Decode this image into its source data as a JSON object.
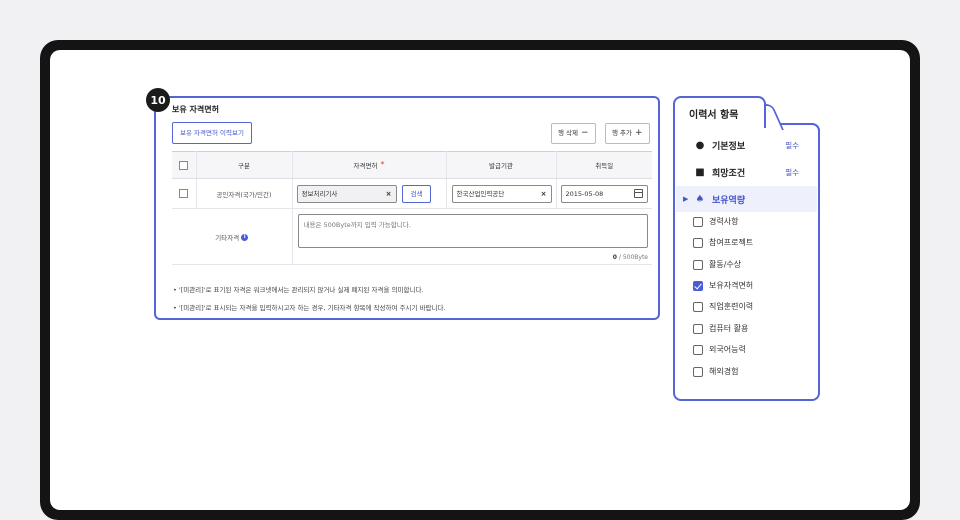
{
  "badge": "10",
  "panel": {
    "title": "보유 자격면허",
    "view_button": "보유 자격면허 이력보기",
    "delete_row": "행 삭제",
    "delete_symbol": "−",
    "add_row": "행 추가",
    "add_symbol": "+",
    "headers": {
      "type": "구분",
      "license": "자격면허",
      "issuer": "발급기관",
      "date": "취득일"
    },
    "required_mark": "*",
    "row": {
      "type": "공인자격(국가/민간)",
      "license_value": "정보처리기사",
      "search_button": "검색",
      "issuer_value": "한국산업인력공단",
      "date_value": "2015-05-08"
    },
    "other": {
      "label": "기타자격",
      "info_icon": "i",
      "placeholder": "내용은 500Byte까지 입력 가능합니다.",
      "count": "0",
      "limit": "/ 500Byte"
    },
    "notes": [
      "• '[미관리]'로 표기된 자격은 워크넷에서는 관리되지 않거나 실제 폐지된 자격을 의미합니다.",
      "• '[미관리]'로 표시되는 자격을 입력하시고자 하는 경우, 기타자격 항목에 작성하여 주시기 바랍니다."
    ],
    "clear_symbol": "×"
  },
  "sidebar": {
    "title": "이력서 항목",
    "sections": [
      {
        "label": "기본정보",
        "required": "필수",
        "icon": "person-circle-icon"
      },
      {
        "label": "희망조건",
        "required": "필수",
        "icon": "document-icon"
      },
      {
        "label": "보유역량",
        "required": "",
        "icon": "skill-icon",
        "active": true
      }
    ],
    "items": [
      {
        "label": "경력사항",
        "checked": false
      },
      {
        "label": "참여프로젝트",
        "checked": false
      },
      {
        "label": "활동/수상",
        "checked": false
      },
      {
        "label": "보유자격면허",
        "checked": true
      },
      {
        "label": "직업훈련이력",
        "checked": false
      },
      {
        "label": "컴퓨터 활용",
        "checked": false
      },
      {
        "label": "외국어능력",
        "checked": false
      },
      {
        "label": "해외경험",
        "checked": false
      }
    ]
  },
  "colors": {
    "accent": "#5466d6",
    "frame": "#141414",
    "required": "#e23b3b"
  }
}
